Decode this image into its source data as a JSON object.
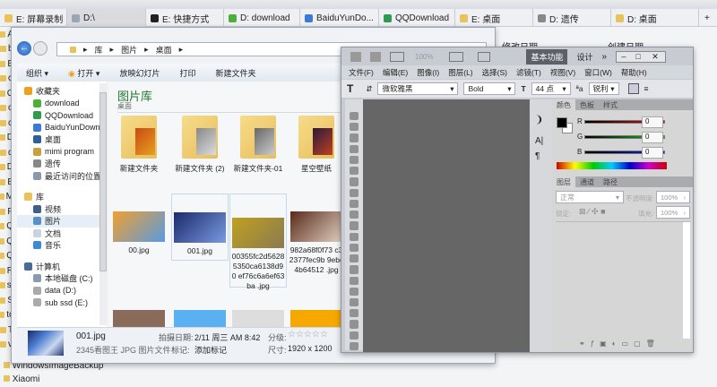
{
  "tabs": [
    {
      "label": "E: 屏幕录制",
      "color": "#e8c25a"
    },
    {
      "label": "D:\\",
      "color": "#9aa6b4",
      "selected": true
    },
    {
      "label": "E: 快捷方式",
      "color": "#222"
    },
    {
      "label": "D: download",
      "color": "#4caf3a"
    },
    {
      "label": "BaiduYunDo...",
      "color": "#3a7bd5"
    },
    {
      "label": "QQDownload",
      "color": "#2e9b4f"
    },
    {
      "label": "E: 桌面",
      "color": "#e8c25a"
    },
    {
      "label": "D: 遗传",
      "color": "#888"
    },
    {
      "label": "D: 桌面",
      "color": "#e8c25a"
    }
  ],
  "add_tab": "+",
  "background": {
    "left_letters": [
      "A",
      "b",
      "B",
      "c",
      "C",
      "c",
      "c",
      "D",
      "d",
      "D",
      "E",
      "M",
      "P",
      "Q",
      "Q",
      "Q",
      "R",
      "sl",
      "S",
      "tc",
      "T",
      "v"
    ],
    "bottom_items": [
      "WindowsImageBackup",
      "Xiaomi"
    ],
    "columns": [
      "修改日期",
      "创建日期"
    ]
  },
  "explorer": {
    "breadcrumb": [
      "库",
      "图片",
      "桌面"
    ],
    "toolbar": [
      "组织 ▾",
      "打开 ▾",
      "放映幻灯片",
      "打印",
      "新建文件夹"
    ],
    "nav": [
      {
        "label": "收藏夹",
        "head": true,
        "color": "#f0a020"
      },
      {
        "label": "download",
        "color": "#4caf3a"
      },
      {
        "label": "QQDownload",
        "color": "#2e9b4f"
      },
      {
        "label": "BaiduYunDownl",
        "color": "#3a7bd5"
      },
      {
        "label": "桌面",
        "color": "#2f5f9a"
      },
      {
        "label": "mimi program",
        "color": "#c9a040"
      },
      {
        "label": "遗传",
        "color": "#888"
      },
      {
        "label": "最近访问的位置",
        "color": "#8899aa"
      },
      {
        "label": "",
        "spacer": true
      },
      {
        "label": "库",
        "head": true,
        "color": "#e8c25a"
      },
      {
        "label": "视频",
        "color": "#3d5f8a"
      },
      {
        "label": "图片",
        "color": "#5a8fc4",
        "selected": true
      },
      {
        "label": "文档",
        "color": "#c9d3de"
      },
      {
        "label": "音乐",
        "color": "#3a8ad5"
      },
      {
        "label": "",
        "spacer": true
      },
      {
        "label": "计算机",
        "head": true,
        "color": "#4a6a9a"
      },
      {
        "label": "本地磁盘 (C:)",
        "color": "#8a9ab0"
      },
      {
        "label": "data (D:)",
        "color": "#aaa"
      },
      {
        "label": "sub ssd (E:)",
        "color": "#aaa"
      }
    ],
    "library_title": "图片库",
    "library_sub": "桌面",
    "folders": [
      "新建文件夹",
      "新建文件夹 (2)",
      "新建文件夹-01",
      "星空壁纸"
    ],
    "images": [
      "00.jpg",
      "001.jpg",
      "00355fc2d5628 5350ca6138d90 ef76c6a6ef63ba .jpg",
      "982a68f0f73 c32377fec9b 9ebc4b64512 .jpg"
    ],
    "details": {
      "filename": "001.jpg",
      "filetype": "2345看图王 JPG 图片文件",
      "date_label": "拍摄日期:",
      "date": "2/11 周三 AM 8:42",
      "tags_label": "标记:",
      "tags": "添加标记",
      "rating_label": "分级:",
      "rating": 0,
      "rating_stars": "☆☆☆☆☆",
      "size_label": "尺寸:",
      "size": "1920 x 1200"
    }
  },
  "photoshop": {
    "zoom": "100%",
    "workspace": "基本功能",
    "design": "设计",
    "more": "»",
    "menu": [
      "文件(F)",
      "编辑(E)",
      "图像(I)",
      "图层(L)",
      "选择(S)",
      "滤镜(T)",
      "视图(V)",
      "窗口(W)",
      "帮助(H)"
    ],
    "options": {
      "font": "微软雅黑",
      "style": "Bold",
      "size": "44 点",
      "aa": "锐利"
    },
    "color_tabs": [
      "颜色",
      "色板",
      "样式"
    ],
    "rgb": [
      {
        "ch": "R",
        "val": "0",
        "color": "#e01010"
      },
      {
        "ch": "G",
        "val": "0",
        "color": "#20c020"
      },
      {
        "ch": "B",
        "val": "0",
        "color": "#1020e0"
      }
    ],
    "layer_tabs": [
      "图层",
      "通道",
      "路径"
    ],
    "blend": "正常",
    "opacity_label": "不透明度:",
    "opacity": "100%",
    "lock_label": "锁定:",
    "fill_label": "填充:",
    "fill": "100%"
  }
}
